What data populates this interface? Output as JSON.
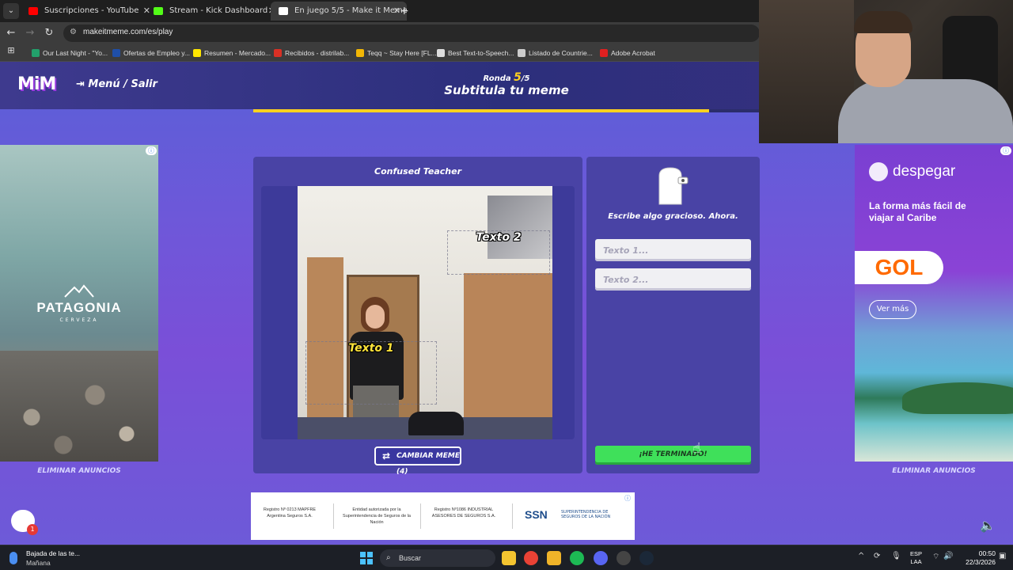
{
  "browser": {
    "tabs": [
      {
        "title": "Suscripciones - YouTube",
        "favicon_color": "#ff0000",
        "active": false
      },
      {
        "title": "Stream - Kick Dashboard",
        "favicon_color": "#53fc18",
        "active": false
      },
      {
        "title": "En juego 5/5 - Make it Meme",
        "favicon_color": "#ffffff",
        "active": true
      }
    ],
    "close_symbol": "✕",
    "new_tab_symbol": "+",
    "url": "makeitmeme.com/es/play",
    "bookmarks": [
      {
        "label": "Our Last Night - \"Yo...",
        "color": "#22a06b"
      },
      {
        "label": "Ofertas de Empleo y...",
        "color": "#1f4fa8"
      },
      {
        "label": "Resumen - Mercado...",
        "color": "#ffe600"
      },
      {
        "label": "Recibidos - distrilab...",
        "color": "#d93025"
      },
      {
        "label": "Teqq ~ Stay Here [FL...",
        "color": "#f2b705"
      },
      {
        "label": "Best Text-to-Speech...",
        "color": "#dddddd"
      },
      {
        "label": "Listado de Countrie...",
        "color": "#cccccc"
      },
      {
        "label": "Adobe Acrobat",
        "color": "#e02020"
      }
    ]
  },
  "header": {
    "logo": "MiM",
    "menu_label": "Menú / Salir",
    "round_prefix": "Ronda",
    "round_current": "5",
    "round_total": "/5",
    "title": "Subtitula tu meme",
    "progress": 0.9
  },
  "game": {
    "meme_name": "Confused Teacher",
    "text1_label": "Texto 1",
    "text2_label": "Texto 2",
    "change_meme_label": "CAMBIAR MEME (4)",
    "hint": "Escribe algo gracioso. Ahora.",
    "input1_placeholder": "Texto 1...",
    "input2_placeholder": "Texto 2...",
    "done_label": "¡HE TERMINADO!"
  },
  "ads": {
    "left_brand": "PATAGONIA",
    "left_brand_sub": "CERVEZA",
    "right_brand": "despegar",
    "right_tagline": "La forma más fácil de viajar al Caribe",
    "right_airline": "GOL",
    "right_cta": "Ver más",
    "remove_ads": "ELIMINAR ANUNCIOS",
    "info_symbol": "ⓘ",
    "bottom": {
      "col1": "Registro Nº 0213 MAPFRE Argentina Seguros S.A.",
      "col2": "Entidad autorizada por la Superintendencia de Seguros de la Nación",
      "col3": "Registro Nº1086 INDUSTRIAL ASESORES DE SEGUROS S.A.",
      "ssn": "SSN",
      "ssn_sub": "SUPERINTENDENCIA DE SEGUROS DE LA NACIÓN"
    }
  },
  "chat_badge": "1",
  "taskbar": {
    "weather_title": "Bajada de las te...",
    "weather_sub": "Mañana",
    "search_label": "Buscar",
    "lang_top": "ESP",
    "lang_bottom": "LAA",
    "time": "00:50",
    "date": "22/3/2026",
    "apps": [
      {
        "name": "file-explorer",
        "color": "#f4c430"
      },
      {
        "name": "chrome",
        "color": "#e94235"
      },
      {
        "name": "folder",
        "color": "#f0b429"
      },
      {
        "name": "spotify",
        "color": "#1db954"
      },
      {
        "name": "discord",
        "color": "#5865f2"
      },
      {
        "name": "obs",
        "color": "#444444"
      },
      {
        "name": "steam",
        "color": "#1b2838"
      }
    ]
  }
}
